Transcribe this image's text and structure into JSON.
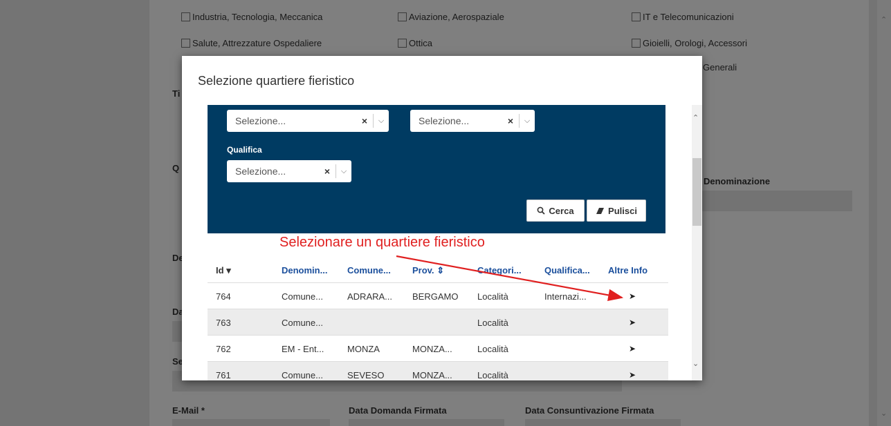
{
  "background": {
    "checkboxes": [
      {
        "label": "Industria, Tecnologia, Meccanica"
      },
      {
        "label": "Aviazione, Aerospaziale"
      },
      {
        "label": "IT e Telecomunicazioni"
      },
      {
        "label": "Salute, Attrezzature Ospedaliere"
      },
      {
        "label": "Ottica"
      },
      {
        "label": "Gioielli, Orologi, Accessori"
      }
    ],
    "partial_text": "Generali",
    "right_denominazione_label": "Denominazione",
    "left_labels": [
      "Ti",
      "Q",
      "De",
      "Da",
      "Se"
    ],
    "bottom_labels": {
      "email": "E-Mail *",
      "data_domanda": "Data Domanda Firmata",
      "data_consuntivazione": "Data Consuntivazione Firmata"
    }
  },
  "modal": {
    "title": "Selezione quartiere fieristico",
    "filters": {
      "select1_placeholder": "Selezione...",
      "select2_placeholder": "Selezione...",
      "qualifica_label": "Qualifica",
      "qualifica_placeholder": "Selezione...",
      "clear_icon": "×",
      "dropdown_icon": "chevron-down-icon"
    },
    "buttons": {
      "search": "Cerca",
      "clear": "Pulisci"
    },
    "annotation": {
      "text": "Selezionare un quartiere fieristico",
      "color": "#e02020"
    },
    "table": {
      "columns": [
        "Id",
        "Denomin...",
        "Comune...",
        "Prov.",
        "Categori...",
        "Qualifica...",
        "Altre Info"
      ],
      "sort_desc_icon": "▾",
      "sort_both_icon": "⇕",
      "rows": [
        {
          "id": "764",
          "denominazione": "Comune...",
          "comune": "ADRARA...",
          "prov": "BERGAMO",
          "categoria": "Località",
          "qualifica": "Internazi..."
        },
        {
          "id": "763",
          "denominazione": "Comune...",
          "comune": "",
          "prov": "",
          "categoria": "Località",
          "qualifica": ""
        },
        {
          "id": "762",
          "denominazione": "EM - Ent...",
          "comune": "MONZA",
          "prov": "MONZA...",
          "categoria": "Località",
          "qualifica": ""
        },
        {
          "id": "761",
          "denominazione": "Comune...",
          "comune": "SEVESO",
          "prov": "MONZA...",
          "categoria": "Località",
          "qualifica": ""
        }
      ]
    }
  },
  "colors": {
    "filter_panel": "#003b62",
    "header_link": "#1b4f9c",
    "annotation": "#e02020"
  }
}
